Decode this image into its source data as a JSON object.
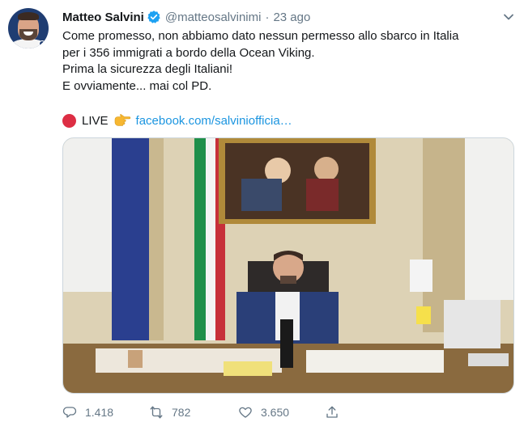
{
  "author": {
    "name": "Matteo Salvini",
    "handle": "@matteosalvinimi",
    "separator": "·",
    "date": "23 ago",
    "verified_color": "#1da1f2"
  },
  "tweet": {
    "lines": [
      "Come promesso, non abbiamo dato nessun permesso allo sbarco in Italia",
      "per i 356 immigrati a bordo della Ocean Viking.",
      "Prima la sicurezza degli Italiani!",
      "E ovviamente... mai col PD."
    ],
    "live_label": "LIVE",
    "link_text": "facebook.com/salviniofficia…",
    "link_color": "#1b95e0"
  },
  "actions": {
    "reply_count": "1.418",
    "retweet_count": "782",
    "like_count": "3.650"
  },
  "icons": {
    "more": "chevron-down-icon",
    "reply": "reply-icon",
    "retweet": "retweet-icon",
    "like": "heart-icon",
    "share": "share-icon",
    "live": "red-circle-icon",
    "pointing": "pointing-hand-icon"
  }
}
